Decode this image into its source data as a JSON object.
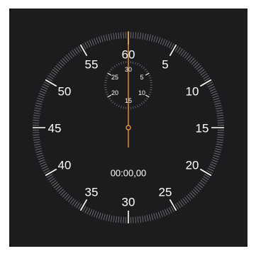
{
  "stopwatch": {
    "elapsed_time": "00:00,00",
    "main_dial_labels": [
      "60",
      "5",
      "10",
      "15",
      "20",
      "25",
      "30",
      "35",
      "40",
      "45",
      "50",
      "55"
    ],
    "sub_dial_labels": [
      "30",
      "5",
      "10",
      "15",
      "20",
      "25"
    ],
    "hand_color": "#e8953a",
    "hand_position_seconds": 0
  }
}
